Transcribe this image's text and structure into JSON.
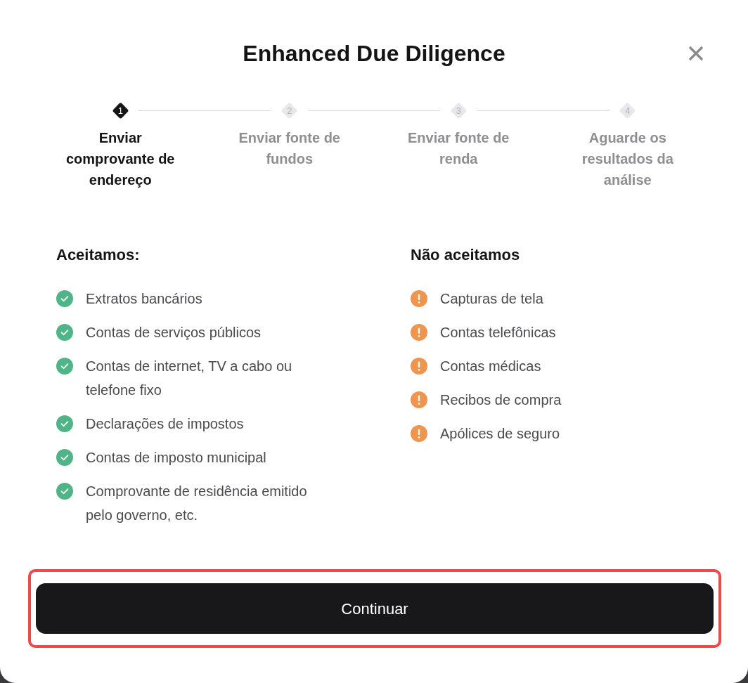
{
  "dialog": {
    "title": "Enhanced Due Diligence"
  },
  "steps": [
    {
      "number": "1",
      "label": "Enviar comprovante de endereço",
      "active": true
    },
    {
      "number": "2",
      "label": "Enviar fonte de fundos",
      "active": false
    },
    {
      "number": "3",
      "label": "Enviar fonte de renda",
      "active": false
    },
    {
      "number": "4",
      "label": "Aguarde os resultados da análise",
      "active": false
    }
  ],
  "sections": [
    {
      "kind": "accepted",
      "heading": "Aceitamos:",
      "items": [
        "Extratos bancários",
        "Contas de serviços públicos",
        "Contas de internet, TV a cabo ou telefone fixo",
        "Declarações de impostos",
        "Contas de imposto municipal",
        "Comprovante de residência emitido pelo governo, etc."
      ]
    },
    {
      "kind": "rejected",
      "heading": "Não aceitamos",
      "items": [
        "Capturas de tela",
        "Contas telefônicas",
        "Contas médicas",
        "Recibos de compra",
        "Apólices de seguro"
      ]
    }
  ],
  "button": {
    "label": "Continuar",
    "highlighted": true
  }
}
